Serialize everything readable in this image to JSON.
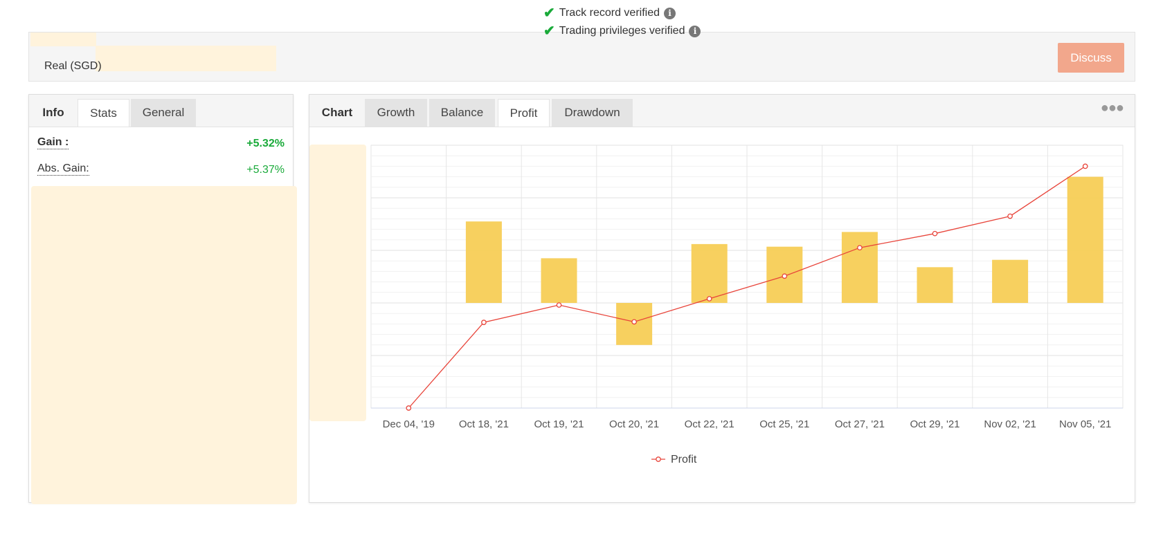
{
  "account": {
    "type_label": "Real (SGD)"
  },
  "verification": [
    {
      "text": "Track record verified"
    },
    {
      "text": "Trading privileges verified"
    }
  ],
  "discuss_button": "Discuss",
  "stats_panel": {
    "tabs": [
      "Info",
      "Stats",
      "General"
    ],
    "active_tab": "Stats",
    "rows": [
      {
        "label": "Gain :",
        "value": "+5.32%"
      },
      {
        "label": "Abs. Gain:",
        "value": "+5.37%"
      }
    ]
  },
  "chart_panel": {
    "heading": "Chart",
    "tabs": [
      "Growth",
      "Balance",
      "Profit",
      "Drawdown"
    ],
    "active_tab": "Profit",
    "menu_icon": "more-dots-icon"
  },
  "colors": {
    "bar": "#f7cd56",
    "line": "#e8443a",
    "positive": "#1aaa3a",
    "discuss": "#f2a78c"
  },
  "chart_data": {
    "type": "bar",
    "categories": [
      "Dec 04, '19",
      "Oct 18, '21",
      "Oct 19, '21",
      "Oct 20, '21",
      "Oct 22, '21",
      "Oct 25, '21",
      "Oct 27, '21",
      "Oct 29, '21",
      "Nov 02, '21",
      "Nov 05, '21"
    ],
    "series": [
      {
        "type": "bar",
        "values": [
          0,
          1.55,
          0.85,
          -0.8,
          1.12,
          1.07,
          1.35,
          0.68,
          0.82,
          2.4
        ]
      },
      {
        "name": "Profit",
        "type": "line",
        "values": [
          -2.0,
          -0.37,
          -0.04,
          -0.36,
          0.08,
          0.51,
          1.05,
          1.32,
          1.65,
          2.6
        ]
      }
    ],
    "ylim": [
      -2.0,
      3.0
    ],
    "y_axis_labels_visible": false,
    "grid": true,
    "legend": "bottom"
  }
}
